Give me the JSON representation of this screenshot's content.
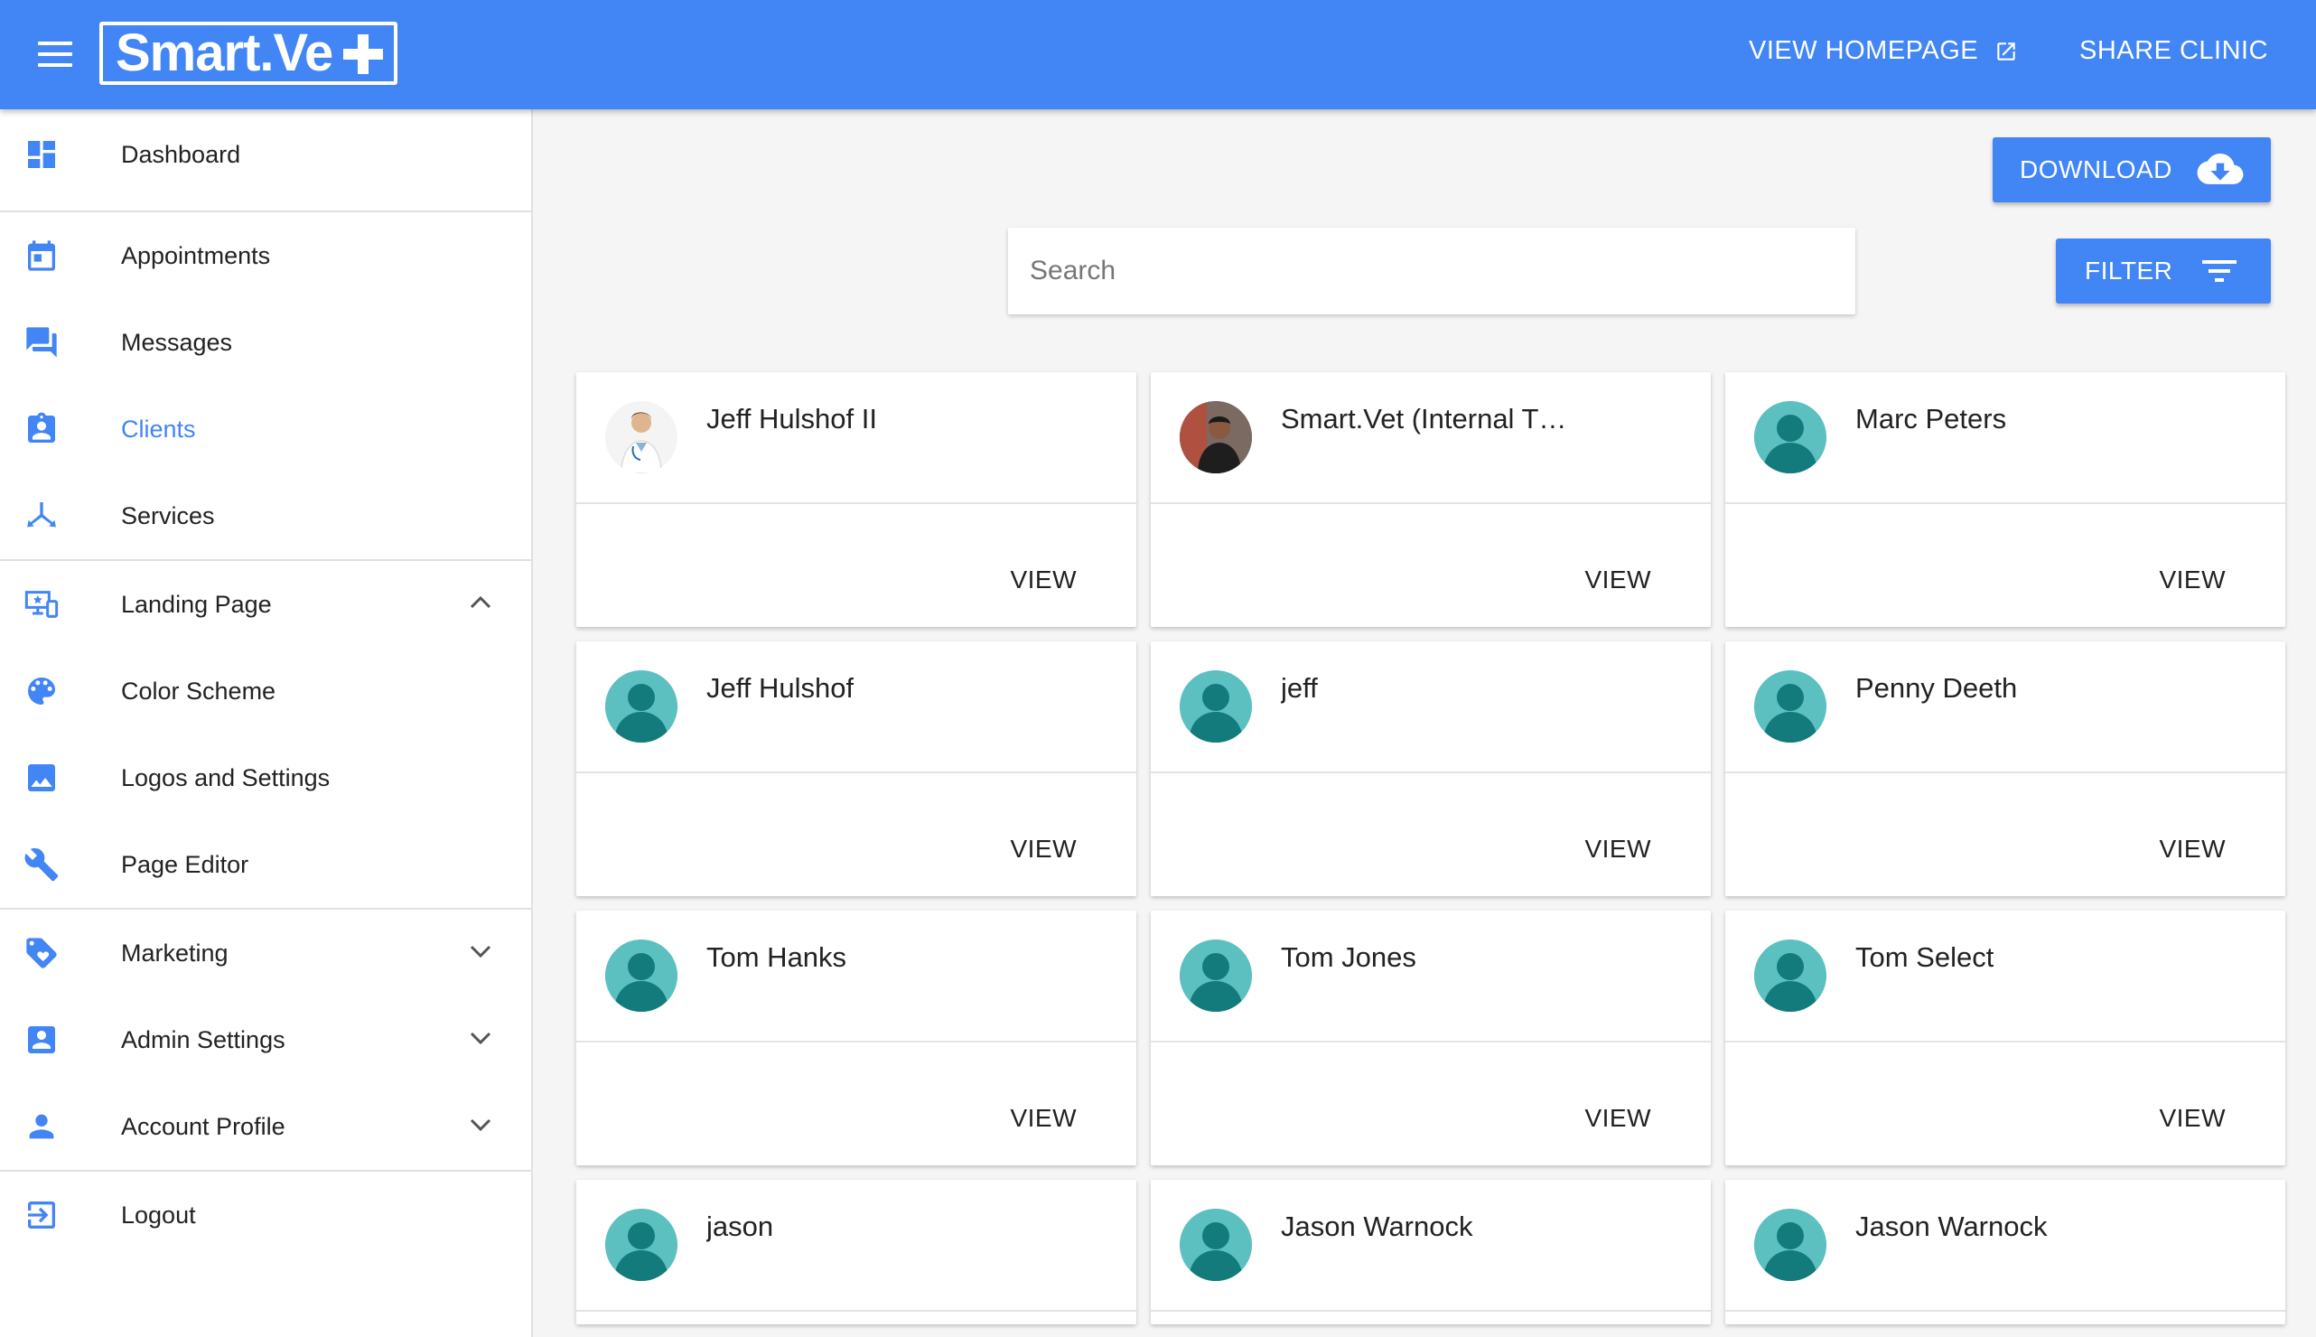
{
  "brand": {
    "logo_text": "Smart.Ve",
    "primary_color": "#4285f4"
  },
  "header": {
    "menu_icon": "hamburger-menu-icon",
    "view_homepage": "VIEW HOMEPAGE",
    "share_clinic": "SHARE CLINIC"
  },
  "sidebar": {
    "items": [
      {
        "label": "Dashboard",
        "icon": "dashboard-icon"
      },
      {
        "label": "Appointments",
        "icon": "calendar-icon"
      },
      {
        "label": "Messages",
        "icon": "forum-icon"
      },
      {
        "label": "Clients",
        "icon": "assignment-ind-icon",
        "active": true
      },
      {
        "label": "Services",
        "icon": "branch-icon"
      },
      {
        "label": "Landing Page",
        "icon": "monitor-devices-icon",
        "expanded": true
      },
      {
        "label": "Color Scheme",
        "icon": "palette-icon"
      },
      {
        "label": "Logos and Settings",
        "icon": "image-icon"
      },
      {
        "label": "Page Editor",
        "icon": "wrench-icon"
      },
      {
        "label": "Marketing",
        "icon": "tag-heart-icon"
      },
      {
        "label": "Admin Settings",
        "icon": "account-box-icon"
      },
      {
        "label": "Account Profile",
        "icon": "person-icon"
      },
      {
        "label": "Logout",
        "icon": "logout-icon"
      }
    ]
  },
  "toolbar": {
    "download_label": "DOWNLOAD",
    "filter_label": "FILTER",
    "search_placeholder": "Search"
  },
  "clients": [
    {
      "name": "Jeff Hulshof II",
      "avatar": "photo-doctor",
      "action": "VIEW"
    },
    {
      "name": "Smart.Vet (Internal T…",
      "avatar": "photo-person",
      "action": "VIEW"
    },
    {
      "name": "Marc Peters",
      "avatar": "default",
      "action": "VIEW"
    },
    {
      "name": "Jeff Hulshof",
      "avatar": "default",
      "action": "VIEW"
    },
    {
      "name": "jeff",
      "avatar": "default",
      "action": "VIEW"
    },
    {
      "name": "Penny Deeth",
      "avatar": "default",
      "action": "VIEW"
    },
    {
      "name": "Tom Hanks",
      "avatar": "default",
      "action": "VIEW"
    },
    {
      "name": "Tom Jones",
      "avatar": "default",
      "action": "VIEW"
    },
    {
      "name": "Tom Select",
      "avatar": "default",
      "action": "VIEW"
    },
    {
      "name": "jason",
      "avatar": "default"
    },
    {
      "name": "Jason Warnock",
      "avatar": "default"
    },
    {
      "name": "Jason Warnock",
      "avatar": "default"
    }
  ]
}
